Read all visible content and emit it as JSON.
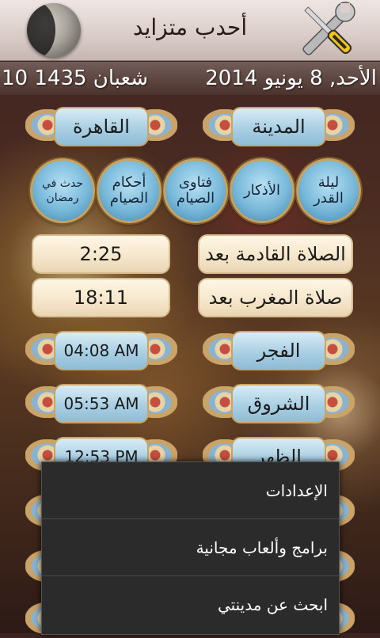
{
  "header": {
    "title": "أحدب متزايد",
    "moon_icon": "moon-phase-icon",
    "settings_icon": "tools-icon"
  },
  "dates": {
    "hijri": "10 شعبان 1435",
    "gregorian": "الأحد, 8 يونيو 2014"
  },
  "location": {
    "city_label": "المدينة",
    "city_value": "القاهرة"
  },
  "shortcuts": [
    {
      "label": "ليلة القدر"
    },
    {
      "label": "الأذكار"
    },
    {
      "label": "فتاوى الصيام"
    },
    {
      "label": "أحكام الصيام"
    },
    {
      "label": "حدث في رمضان"
    }
  ],
  "countdowns": [
    {
      "label": "الصلاة القادمة بعد",
      "value": "2:25"
    },
    {
      "label": "صلاة المغرب بعد",
      "value": "18:11"
    }
  ],
  "prayers": [
    {
      "name": "الفجر",
      "time": "04:08 AM"
    },
    {
      "name": "الشروق",
      "time": "05:53 AM"
    },
    {
      "name": "الظهر",
      "time": "12:53 PM"
    }
  ],
  "menu": {
    "items": [
      {
        "label": "الإعدادات"
      },
      {
        "label": "برامج وألعاب مجانية"
      },
      {
        "label": "ابحث عن مدينتي"
      }
    ]
  },
  "colors": {
    "pill_blue": "#a9cfe3",
    "pill_cream": "#f5e6ca",
    "frame_gold": "#c9a465",
    "menu_bg": "#2b2b2b"
  }
}
